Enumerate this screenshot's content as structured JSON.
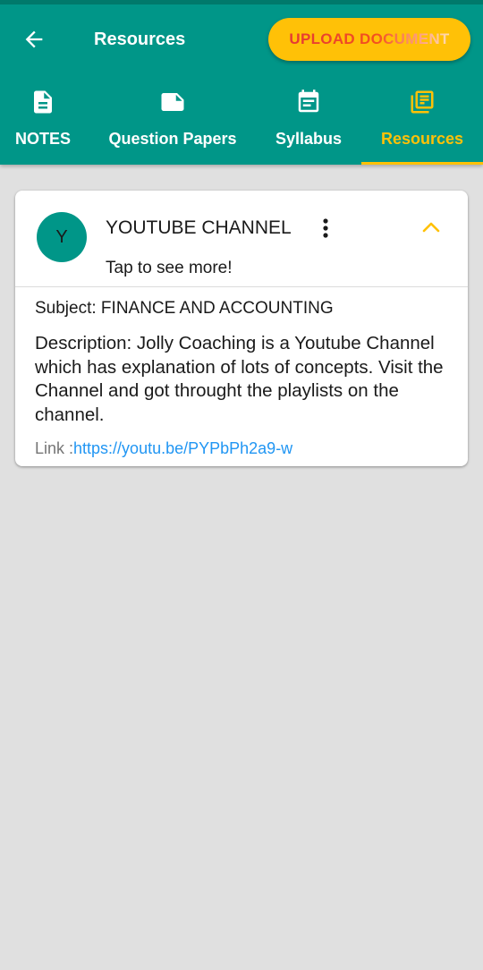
{
  "header": {
    "title": "Resources",
    "upload_label": "UPLOAD DOCUMENT",
    "back_icon": "arrow-back-icon"
  },
  "tabs": [
    {
      "label": "NOTES",
      "icon": "document-icon",
      "active": false
    },
    {
      "label": "Question Papers",
      "icon": "note-icon",
      "active": false
    },
    {
      "label": "Syllabus",
      "icon": "calendar-icon",
      "active": false
    },
    {
      "label": "Resources",
      "icon": "library-books-icon",
      "active": true
    }
  ],
  "card": {
    "avatar_letter": "Y",
    "title": "YOUTUBE CHANNEL",
    "subtitle": "Tap to see more!",
    "subject": "Subject: FINANCE AND ACCOUNTING",
    "description": "Description: Jolly Coaching is a Youtube Channel which has explanation of lots of concepts. Visit the Channel and got throught the playlists on the channel.",
    "link_label": "Link :",
    "link_url": "https://youtu.be/PYPbPh2a9-w"
  },
  "colors": {
    "primary": "#009688",
    "accent": "#ffc107",
    "upload_text": "#e53935",
    "link": "#2196f3",
    "background": "#e0e0e0"
  }
}
